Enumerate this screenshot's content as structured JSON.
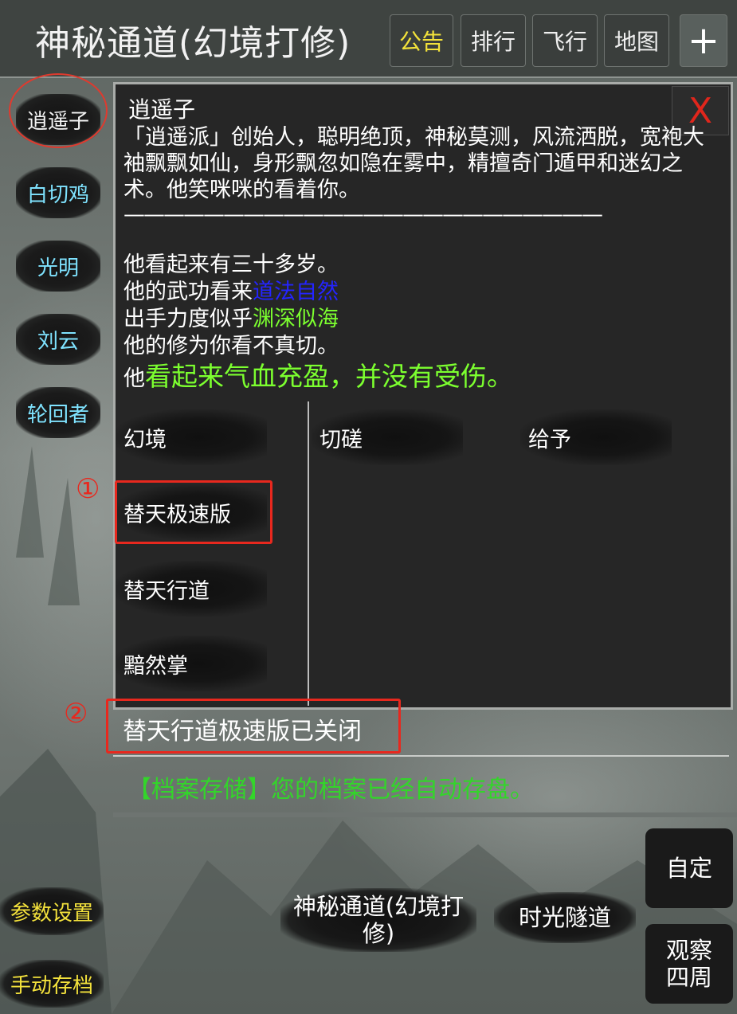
{
  "header": {
    "title": "神秘通道(幻境打修)",
    "buttons": {
      "notice": "公告",
      "rank": "排行",
      "fly": "飞行",
      "map": "地图",
      "plus": "+"
    }
  },
  "sidebar": {
    "npcs": [
      "逍遥子",
      "白切鸡",
      "光明",
      "刘云",
      "轮回者"
    ],
    "selected": "逍遥子",
    "settings": "参数设置",
    "manual_save": "手动存档"
  },
  "dialog": {
    "close": "X",
    "name": "逍遥子",
    "description": "「逍遥派」创始人，聪明绝顶，神秘莫测，风流洒脱，宽袍大袖飘飘如仙，身形飘忽如隐在雾中，精擅奇门遁甲和迷幻之术。他笑咪咪的看着你。",
    "rule": "————————————————————————",
    "age": "他看起来有三十多岁。",
    "martial_prefix": "他的武功看来",
    "martial_value": "道法自然",
    "force_prefix": "出手力度似乎",
    "force_value": "渊深似海",
    "cultivation": "他的修为你看不真切。",
    "health_prefix": "他",
    "health_value": "看起来气血充盈，并没有受伤。",
    "skills_left": [
      "幻境",
      "替天极速版",
      "替天行道",
      "黯然掌"
    ],
    "actions": [
      "切磋",
      "给予"
    ]
  },
  "annotations": {
    "mark1": "①",
    "mark2": "②"
  },
  "messages": {
    "system": "替天行道极速版已关闭",
    "save": "【档案存储】您的档案已经自动存盘。"
  },
  "bottom": {
    "location": "神秘通道(幻境打修)",
    "tunnel": "时光隧道",
    "custom": "自定",
    "observe": "观察四周"
  },
  "colors": {
    "npc_name": "#7fe3ff",
    "notice": "#f3e23a",
    "martial_blue": "#2424ff",
    "force_green": "#7cff2f",
    "save_green": "#33d52a",
    "mark_red": "#e8281e"
  }
}
